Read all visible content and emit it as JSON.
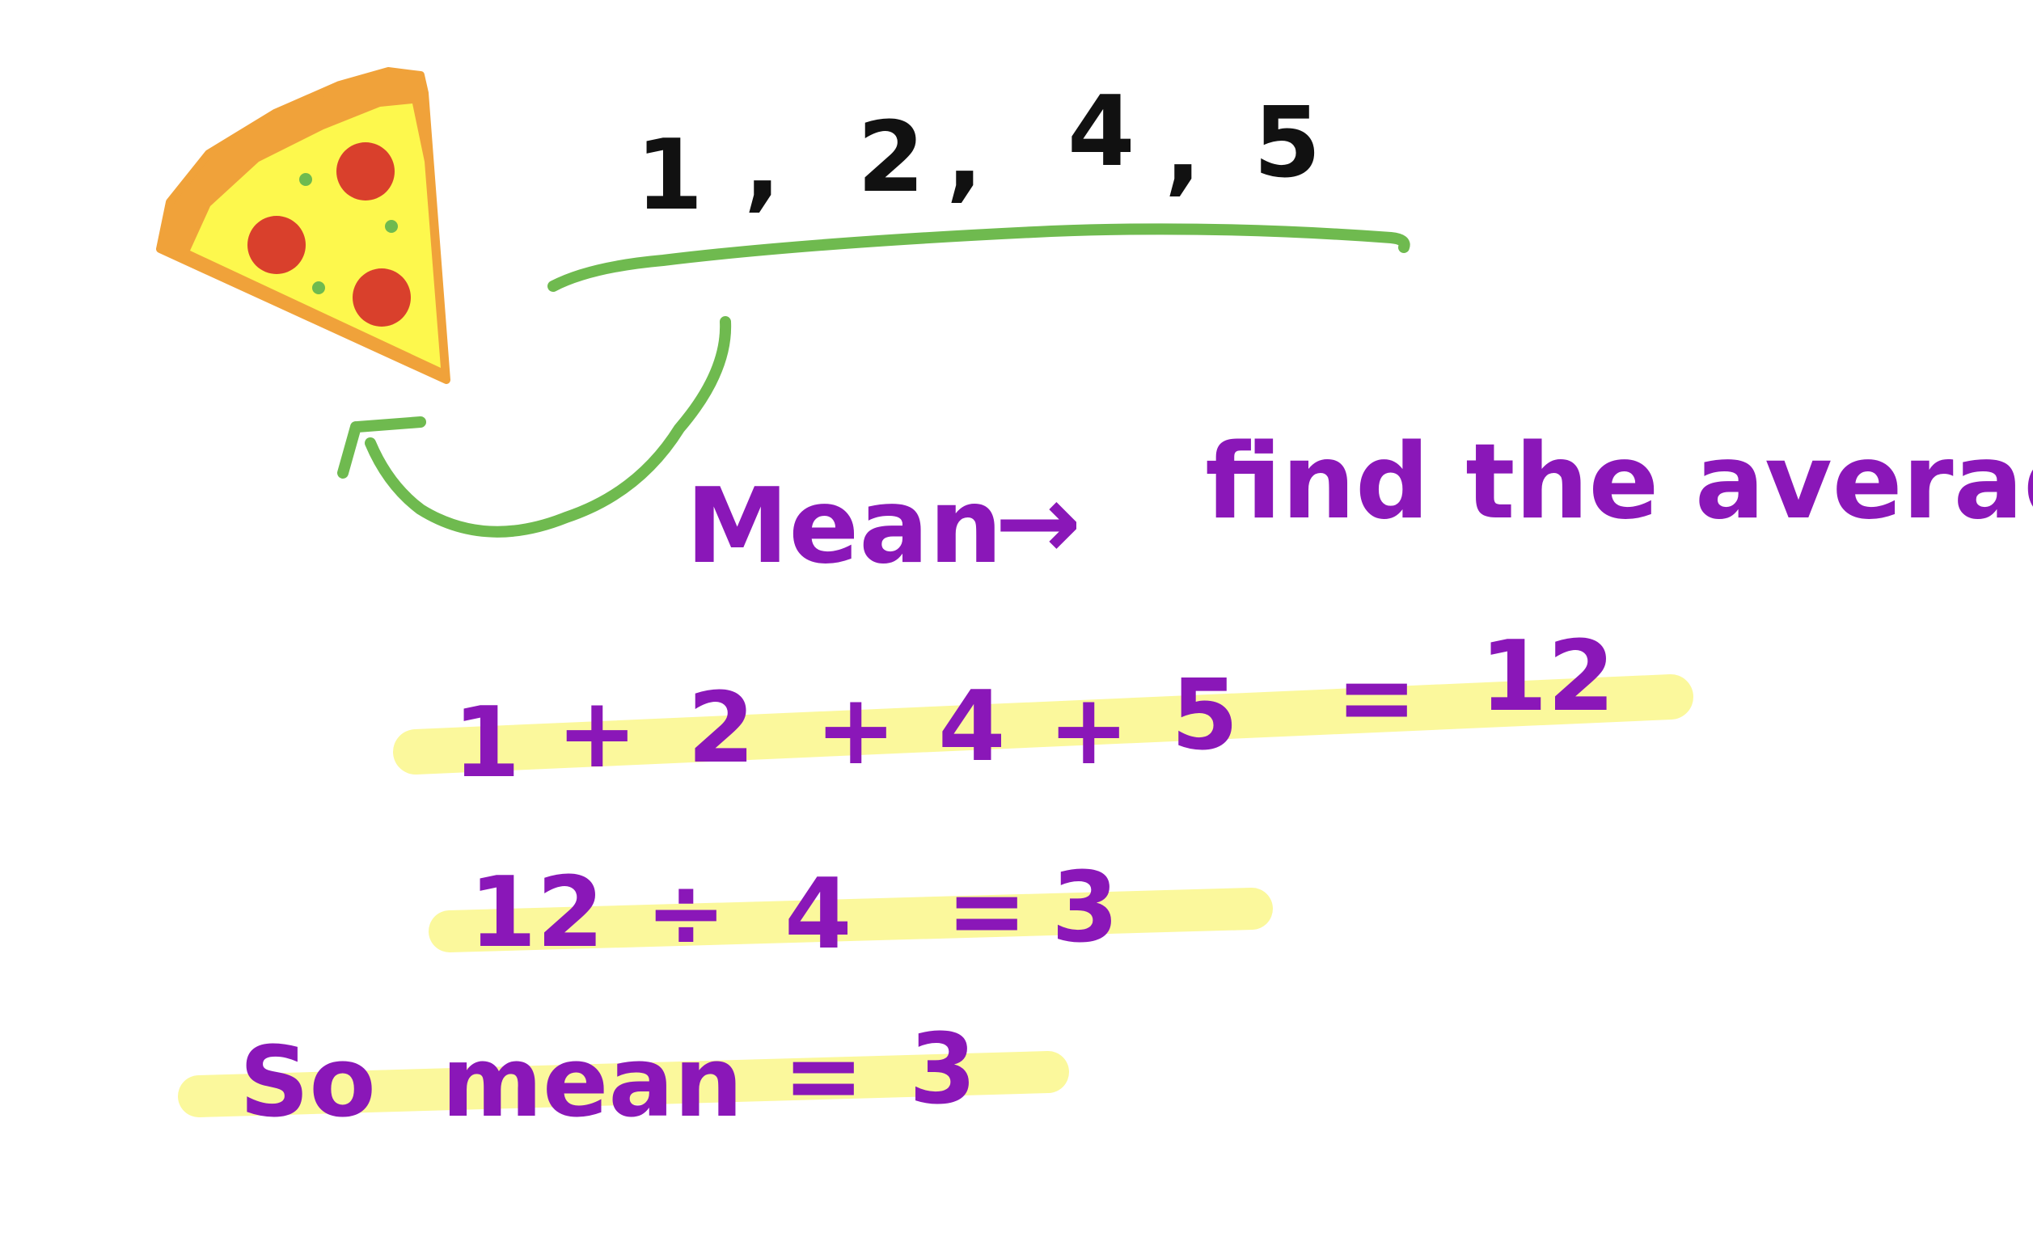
{
  "numbers": [
    "1",
    ",",
    "2",
    ",",
    "4",
    ",",
    "5"
  ],
  "mean_label": "Mean",
  "arrow_text": "→",
  "definition": "find the average",
  "equations": {
    "sum": {
      "tokens": [
        "1",
        "+",
        "2",
        "+",
        "4",
        "+",
        "5",
        "=",
        "12"
      ]
    },
    "division": {
      "tokens": [
        "12",
        "÷",
        "4",
        "=",
        "3"
      ]
    },
    "conclusion": {
      "tokens": [
        "So",
        "mean",
        "=",
        "3"
      ]
    }
  },
  "colors": {
    "black_ink": "#111111",
    "purple_ink": "#8a17b8",
    "green_ink": "#6fba4f",
    "highlight": "#fbf89c",
    "pizza_crust": "#f0a23a",
    "pizza_cheese": "#fdf84d",
    "pepperoni": "#d9402c",
    "basil": "#6fba4f"
  },
  "icons": {
    "pizza": "pizza-slice-icon",
    "curved_arrow": "curved-arrow-icon"
  }
}
